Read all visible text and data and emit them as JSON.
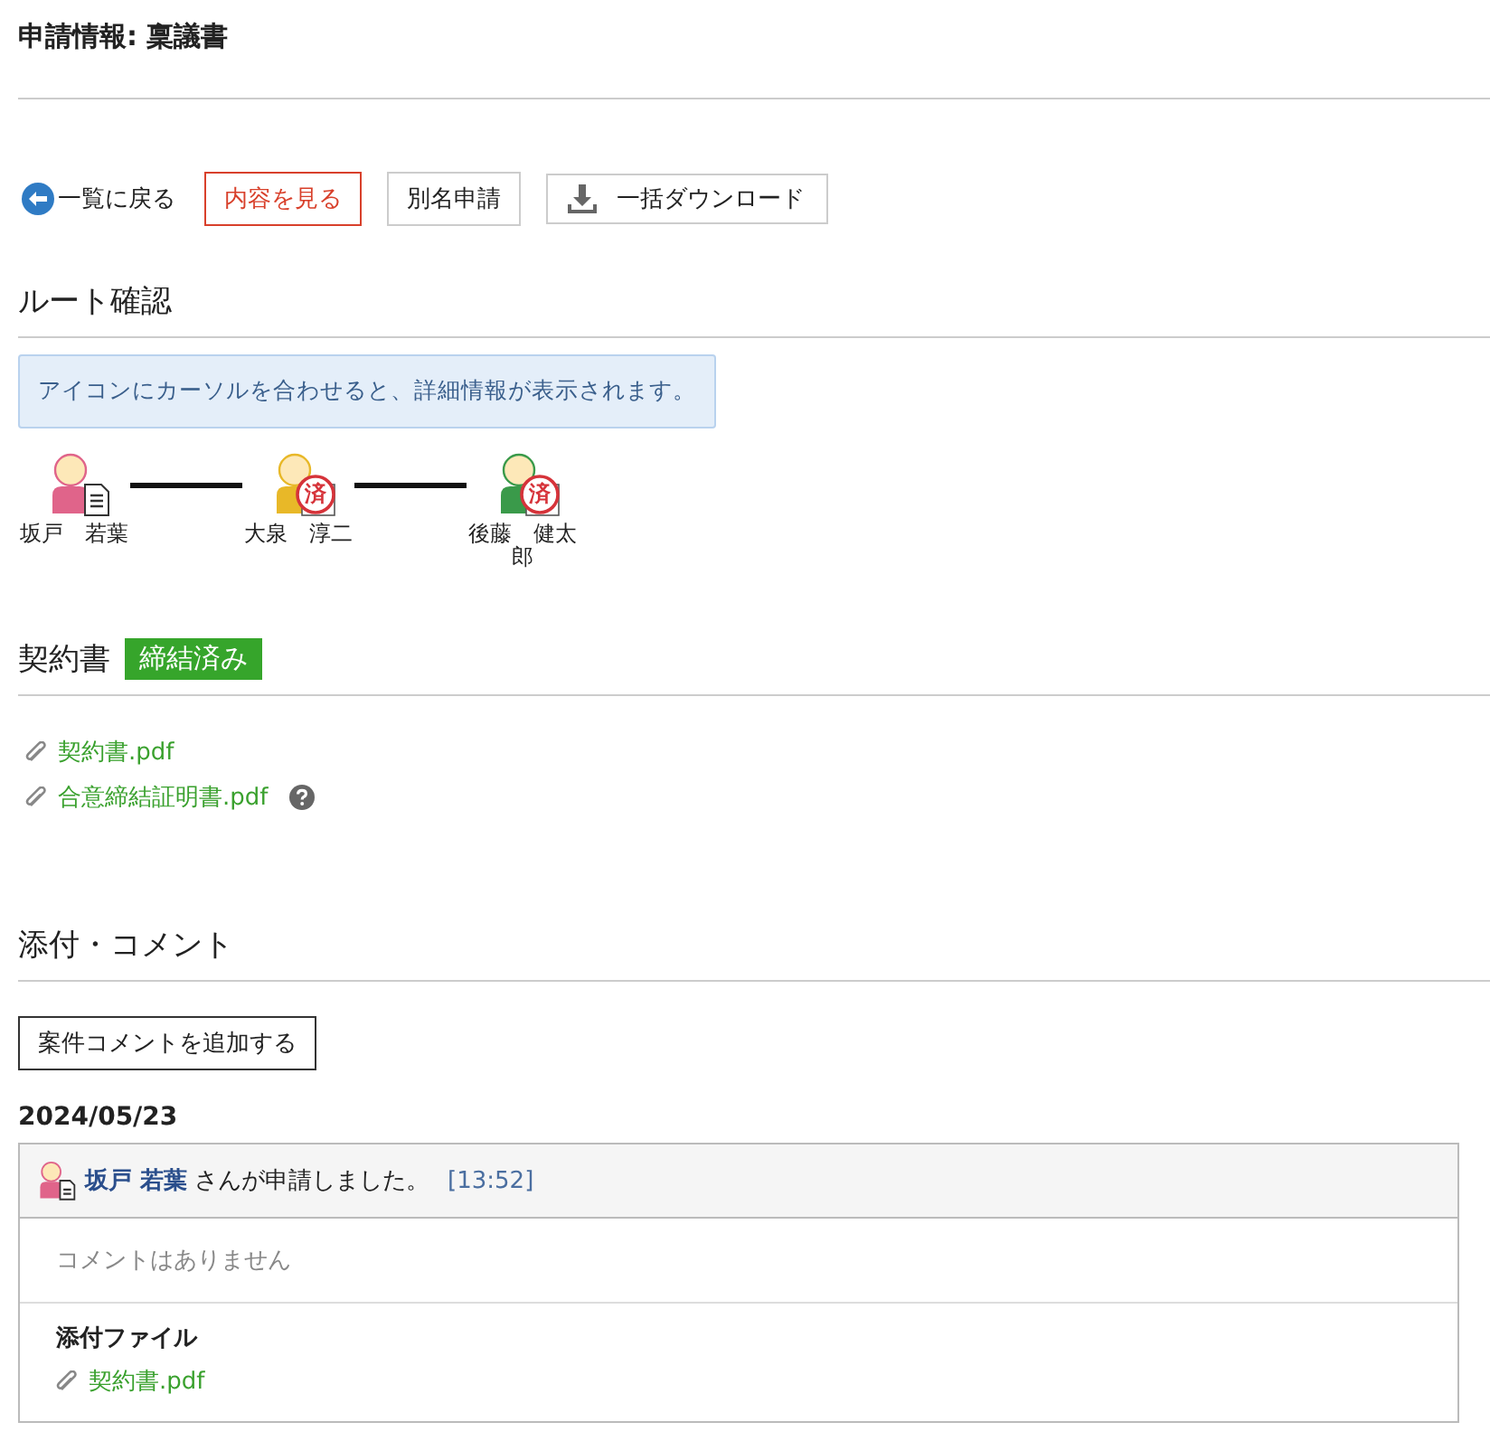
{
  "page_title": "申請情報: 稟議書",
  "toolbar": {
    "back_link": "一覧に戻る",
    "buttons": [
      {
        "label": "内容を見る",
        "kind": "primary"
      },
      {
        "label": "別名申請",
        "kind": "plain"
      },
      {
        "label": "一括ダウンロード",
        "kind": "download"
      }
    ]
  },
  "route": {
    "heading": "ルート確認",
    "info": "アイコンにカーソルを合わせると、詳細情報が表示されます。",
    "nodes": [
      {
        "name": "坂戸　若葉",
        "color": "#e0648a",
        "kind": "applicant"
      },
      {
        "name": "大泉　淳二",
        "color": "#e8b828",
        "kind": "approved",
        "stamp": "済"
      },
      {
        "name": "後藤　健太郎",
        "color": "#3a9a4a",
        "kind": "approved",
        "stamp": "済"
      }
    ]
  },
  "contract": {
    "heading": "契約書",
    "status_badge": "締結済み",
    "files": [
      {
        "name": "契約書.pdf",
        "help": false
      },
      {
        "name": "合意締結証明書.pdf",
        "help": true
      }
    ]
  },
  "comments": {
    "heading": "添付・コメント",
    "add_button": "案件コメントを追加する",
    "date": "2024/05/23",
    "entries": [
      {
        "applicant": "坂戸 若葉",
        "message": "さんが申請しました。",
        "time": "[13:52]",
        "comment": "コメントはありません",
        "attachments_label": "添付ファイル",
        "attachments": [
          "契約書.pdf"
        ]
      }
    ]
  }
}
